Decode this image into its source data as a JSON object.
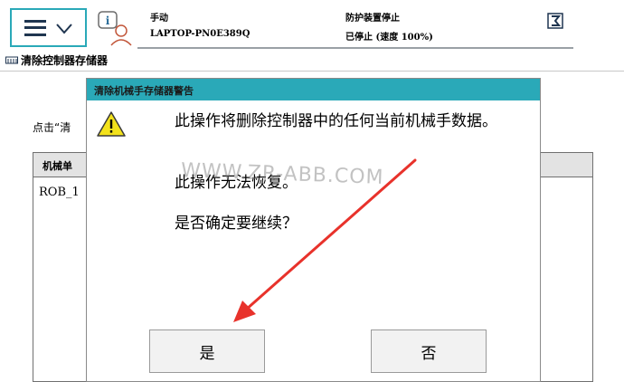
{
  "status": {
    "mode": "手动",
    "controller_name": "LAPTOP-PN0E389Q",
    "safety_state": "防护装置停止",
    "run_state": "已停止 (速度 100%)"
  },
  "page": {
    "title": "清除控制器存储器",
    "instruction": "点击“清",
    "table_header": "机械单",
    "row_1": "ROB_1"
  },
  "dialog": {
    "title": "清除机械手存储器警告",
    "message_1": "此操作将删除控制器中的任何当前机械手数据。",
    "message_2": "此操作无法恢复。",
    "message_3": "是否确定要继续？",
    "yes_label": "是",
    "no_label": "否"
  },
  "watermark": "WWW.ZR-ABB.COM",
  "colors": {
    "accent": "#2aa9b8",
    "warning": "#f3e21b",
    "arrow": "#e8322b"
  }
}
